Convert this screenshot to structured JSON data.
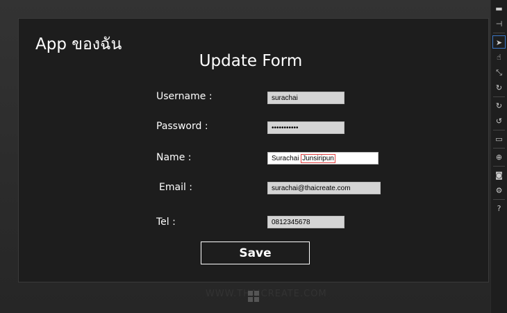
{
  "app_title": "App ของฉัน",
  "form_title": "Update Form",
  "fields": {
    "username": {
      "label": "Username :",
      "value": "surachai"
    },
    "password": {
      "label": "Password :",
      "value": "•••••••••••"
    },
    "name": {
      "label": "Name :",
      "value_first": "Surachai",
      "value_selected": "Junsiripun"
    },
    "email": {
      "label": "Email :",
      "value": "surachai@thaicreate.com"
    },
    "tel": {
      "label": "Tel :",
      "value": "0812345678"
    }
  },
  "save_label": "Save",
  "watermark": "WWW.THAICREATE.COM",
  "toolbar": {
    "minimize": "▬",
    "pin": "⊣",
    "pointer": "➤",
    "touch": "☝",
    "pinch": "⤡",
    "rotate_touch": "↻",
    "rotate_cw": "↻",
    "rotate_ccw": "↺",
    "resolution": "▭",
    "location": "⊕",
    "screenshot": "◙",
    "settings": "⚙",
    "help": "?"
  }
}
